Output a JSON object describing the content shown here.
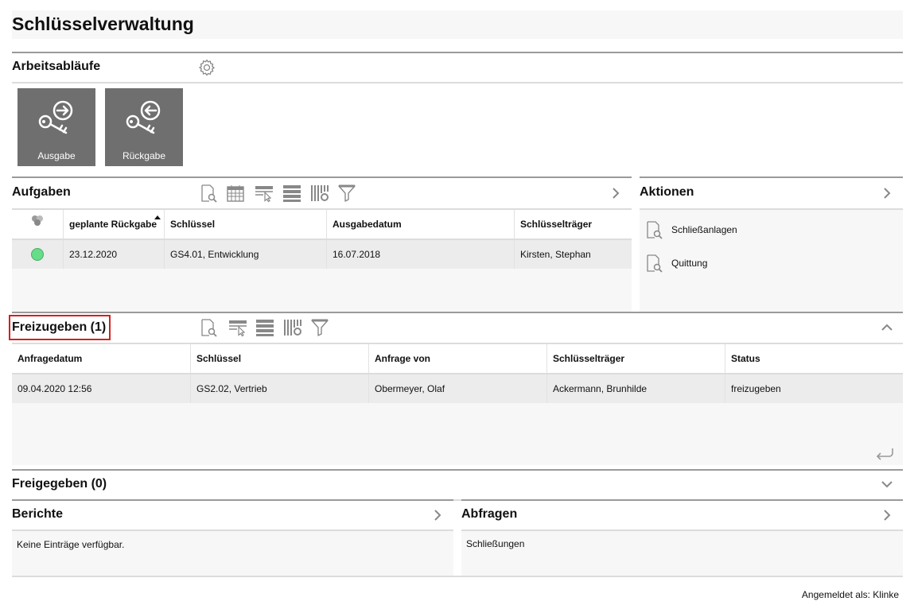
{
  "page": {
    "title": "Schlüsselverwaltung"
  },
  "workflows": {
    "title": "Arbeitsabläufe",
    "tiles": [
      {
        "label": "Ausgabe",
        "icon": "key-out-icon"
      },
      {
        "label": "Rückgabe",
        "icon": "key-return-icon"
      }
    ]
  },
  "tasks": {
    "title": "Aufgaben",
    "columns": [
      "geplante Rückgabe",
      "Schlüssel",
      "Ausgabedatum",
      "Schlüsselträger"
    ],
    "rows": [
      {
        "status_color": "#66dd88",
        "planned_return": "23.12.2020",
        "key": "GS4.01, Entwicklung",
        "issue_date": "16.07.2018",
        "holder": "Kirsten, Stephan"
      }
    ]
  },
  "actions": {
    "title": "Aktionen",
    "items": [
      {
        "label": "Schließanlagen"
      },
      {
        "label": "Quittung"
      }
    ]
  },
  "to_release": {
    "title": "Freizugeben (1)",
    "columns": [
      "Anfragedatum",
      "Schlüssel",
      "Anfrage von",
      "Schlüsselträger",
      "Status"
    ],
    "rows": [
      {
        "request_date": "09.04.2020 12:56",
        "key": "GS2.02, Vertrieb",
        "requested_by": "Obermeyer, Olaf",
        "holder": "Ackermann, Brunhilde",
        "status": "freizugeben"
      }
    ]
  },
  "released": {
    "title": "Freigegeben (0)"
  },
  "reports": {
    "title": "Berichte",
    "empty_text": "Keine Einträge verfügbar."
  },
  "queries": {
    "title": "Abfragen",
    "items": [
      {
        "label": "Schließungen"
      }
    ]
  },
  "footer": {
    "logged_in_as": "Angemeldet als: Klinke"
  },
  "colors": {
    "tile_bg": "#6f6f6f",
    "status_ok": "#66dd88",
    "highlight": "#d42020"
  }
}
